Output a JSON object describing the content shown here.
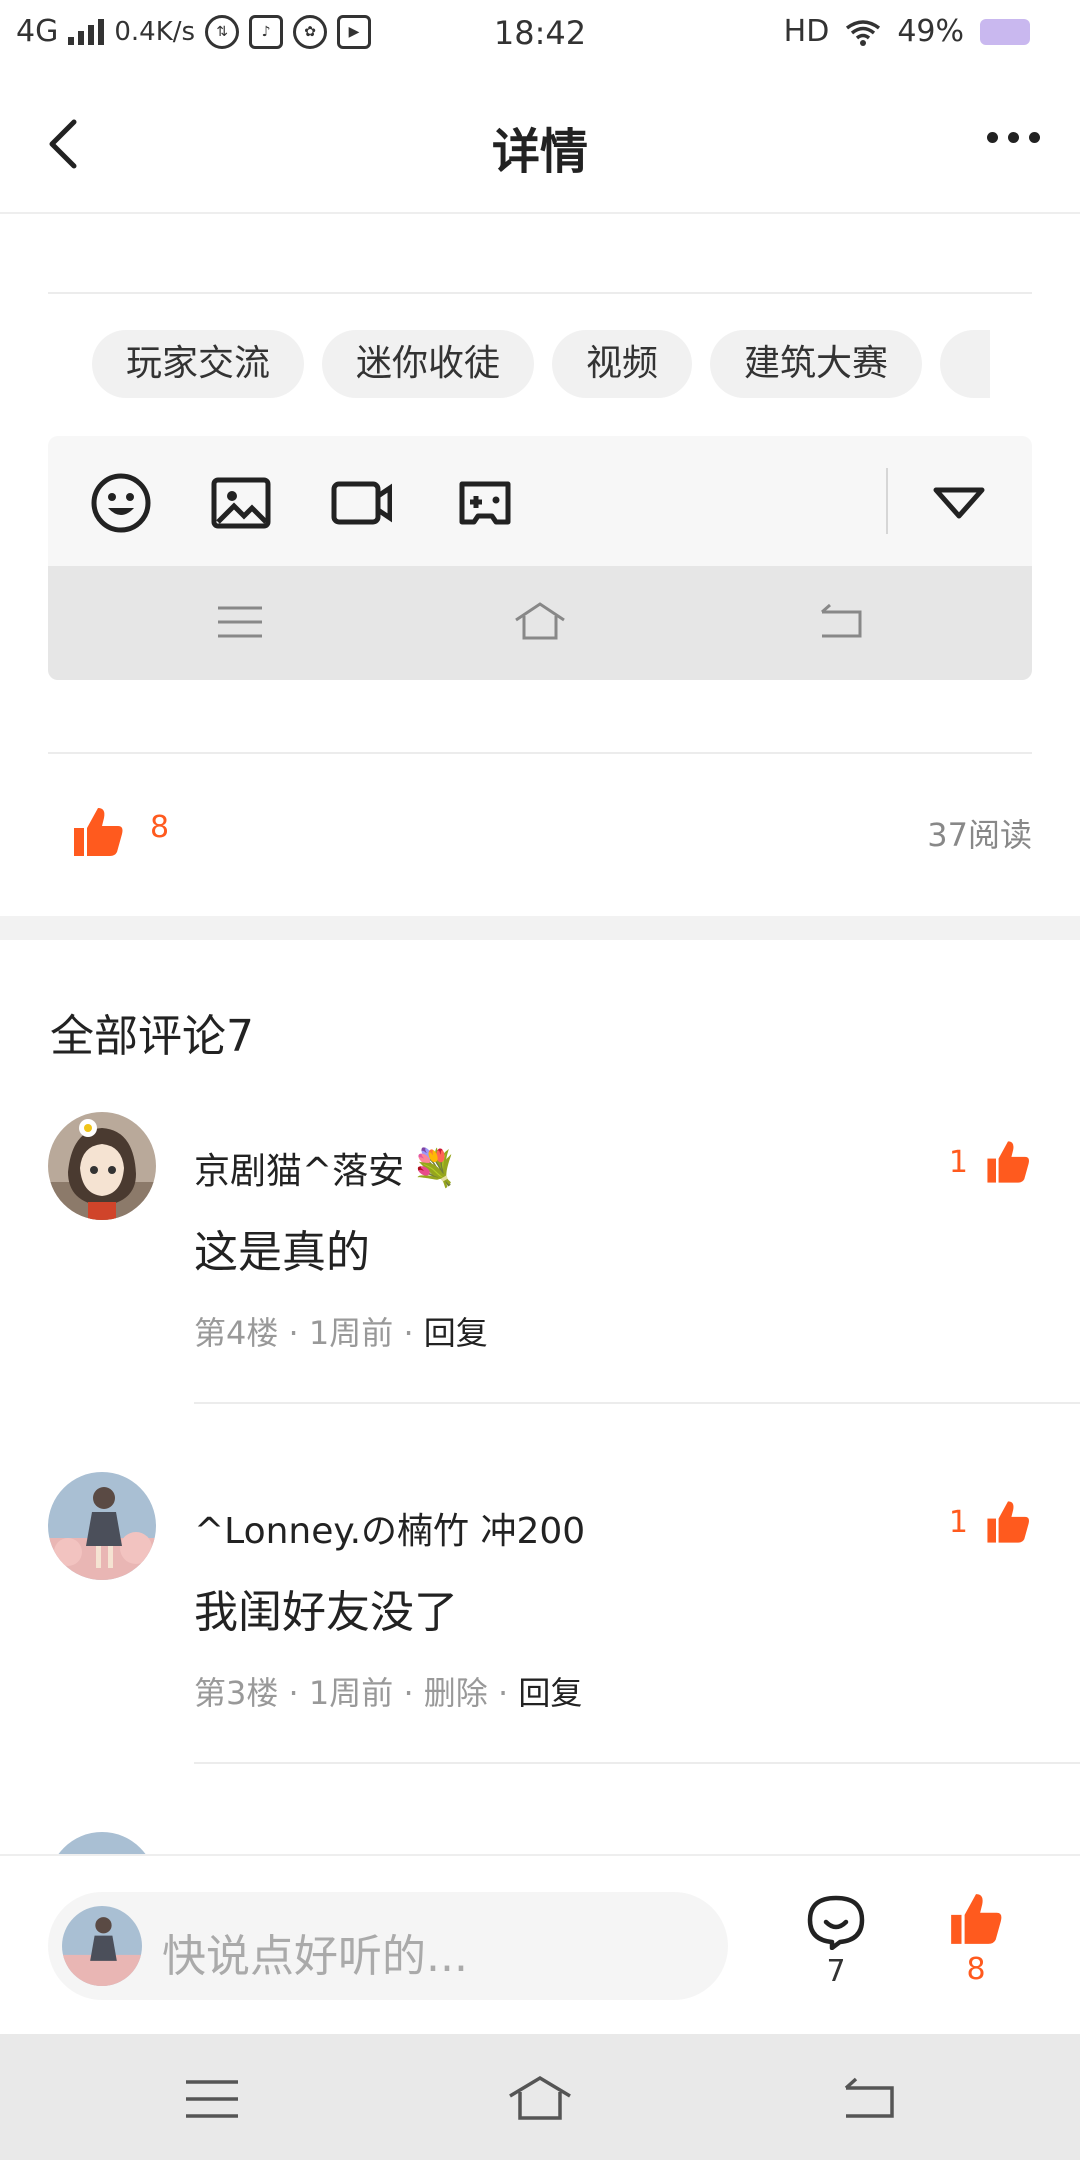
{
  "status_bar": {
    "network": "4G",
    "speed": "0.4K/s",
    "time": "18:42",
    "hd": "HD",
    "battery": "49%"
  },
  "header": {
    "title": "详情"
  },
  "tags": [
    "玩家交流",
    "迷你收徒",
    "视频",
    "建筑大赛",
    ""
  ],
  "stats": {
    "likes": "8",
    "reads": "37阅读"
  },
  "comments_section": {
    "title": "全部评论7"
  },
  "comments": [
    {
      "user": "京剧猫^落安",
      "badge": "💐",
      "text": "这是真的",
      "floor": "第4楼",
      "time": "1周前",
      "actions": [
        "回复"
      ],
      "likes": "1"
    },
    {
      "user": "^Lonney.の楠竹 冲200",
      "badge": "",
      "text": "我闺好友没了",
      "floor": "第3楼",
      "time": "1周前",
      "actions": [
        "删除",
        "回复"
      ],
      "likes": "1"
    }
  ],
  "bottom_bar": {
    "placeholder": "快说点好听的...",
    "comment_count": "7",
    "like_count": "8"
  },
  "colors": {
    "accent": "#ff5a1e",
    "divider": "#ececec"
  }
}
